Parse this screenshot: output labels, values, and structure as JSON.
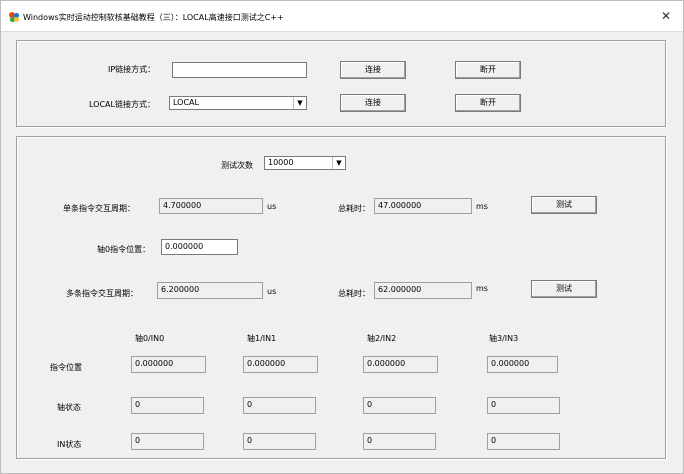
{
  "window": {
    "title": "Windows实时运动控制软核基础教程（三）：LOCAL高速接口测试之C++",
    "close_glyph": "✕"
  },
  "connect": {
    "ip_label": "IP链接方式：",
    "ip_value": "",
    "local_label": "LOCAL链接方式：",
    "local_value": "LOCAL",
    "connect_label": "连接",
    "disconnect_label": "断开"
  },
  "test": {
    "count_label": "测试次数",
    "count_value": "10000",
    "single_label": "单条指令交互周期：",
    "single_value": "4.700000",
    "single_unit": "us",
    "total_label": "总耗时：",
    "single_total_value": "47.000000",
    "total_unit": "ms",
    "test_label": "测试",
    "axis0_pos_label": "轴0指令位置：",
    "axis0_pos_value": "0.000000",
    "multi_label": "多条指令交互周期：",
    "multi_value": "6.200000",
    "multi_unit": "us",
    "multi_total_value": "62.000000"
  },
  "axes": {
    "headers": [
      "轴0/IN0",
      "轴1/IN1",
      "轴2/IN2",
      "轴3/IN3"
    ],
    "rows": [
      {
        "label": "指令位置",
        "values": [
          "0.000000",
          "0.000000",
          "0.000000",
          "0.000000"
        ]
      },
      {
        "label": "轴状态",
        "values": [
          "0",
          "0",
          "0",
          "0"
        ]
      },
      {
        "label": "IN状态",
        "values": [
          "0",
          "0",
          "0",
          "0"
        ]
      }
    ]
  }
}
